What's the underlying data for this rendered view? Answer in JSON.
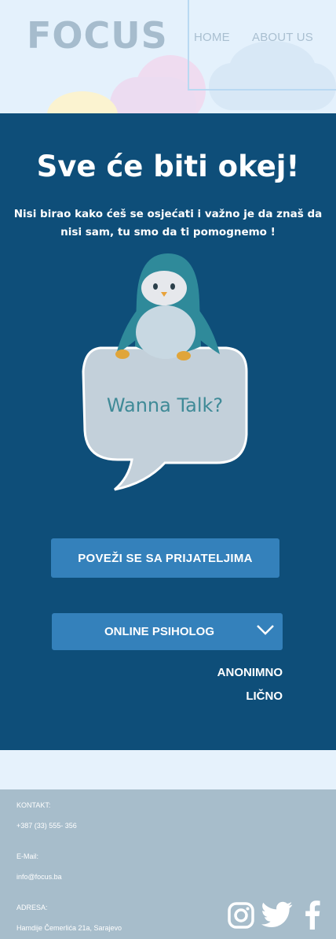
{
  "header": {
    "logo": "FOCUS",
    "nav": {
      "home": "HOME",
      "about": "ABOUT US"
    }
  },
  "hero": {
    "title": "Sve će biti okej!",
    "subtitle": "Nisi birao kako ćeš se osjećati i važno je da znaš da nisi sam, tu smo da ti pomognemo !",
    "illustration_text": "Wanna Talk?"
  },
  "actions": {
    "connect_friends": "POVEŽI SE SA PRIJATELJIMA",
    "online_psych": "ONLINE PSIHOLOG",
    "dropdown_options": [
      "ANONIMNO",
      "LIČNO"
    ]
  },
  "footer": {
    "contact_label": "KONTAKT:",
    "phone": "+387 (33) 555- 356",
    "email_label": "E-Mail:",
    "email": "info@focus.ba",
    "address_label": "ADRESA:",
    "address": "Hamdije Čemerlića 21a, Sarajevo",
    "social_icons": [
      "instagram-icon",
      "twitter-icon",
      "facebook-icon"
    ]
  },
  "colors": {
    "header_bg": "#e4f1fc",
    "main_bg": "#0e4e79",
    "button": "#3481bb",
    "footer_bg": "#a7bdcb",
    "logo": "#a6bccd"
  }
}
